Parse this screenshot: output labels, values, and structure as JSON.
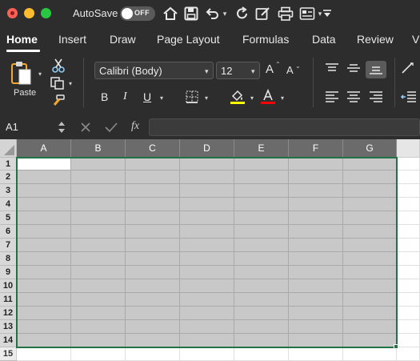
{
  "app": {
    "autosave_label": "AutoSave",
    "autosave_state": "OFF",
    "quick_access": [
      "home-icon",
      "save-icon",
      "undo-icon",
      "redo-icon",
      "edit-doc-icon",
      "print-icon",
      "form-icon",
      "customize-icon"
    ]
  },
  "tabs": [
    {
      "label": "Home",
      "active": true
    },
    {
      "label": "Insert"
    },
    {
      "label": "Draw"
    },
    {
      "label": "Page Layout"
    },
    {
      "label": "Formulas"
    },
    {
      "label": "Data"
    },
    {
      "label": "Review"
    },
    {
      "label": "V"
    }
  ],
  "ribbon": {
    "paste_label": "Paste",
    "font_name": "Calibri (Body)",
    "font_size": "12",
    "grow_font": "A",
    "shrink_font": "A",
    "bold": "B",
    "italic": "I",
    "underline": "U",
    "highlight_color": "#ffff00",
    "font_color": "#ff0000"
  },
  "formula_bar": {
    "name_box": "A1",
    "fx_label": "fx",
    "formula": ""
  },
  "sheet": {
    "columns": [
      "A",
      "B",
      "C",
      "D",
      "E",
      "F",
      "G"
    ],
    "rows": [
      "1",
      "2",
      "3",
      "4",
      "5",
      "6",
      "7",
      "8",
      "9",
      "10",
      "11",
      "12",
      "13",
      "14",
      "15"
    ],
    "active_cell": "A1",
    "selection": "A1:G14",
    "selection_color": "#217346"
  }
}
